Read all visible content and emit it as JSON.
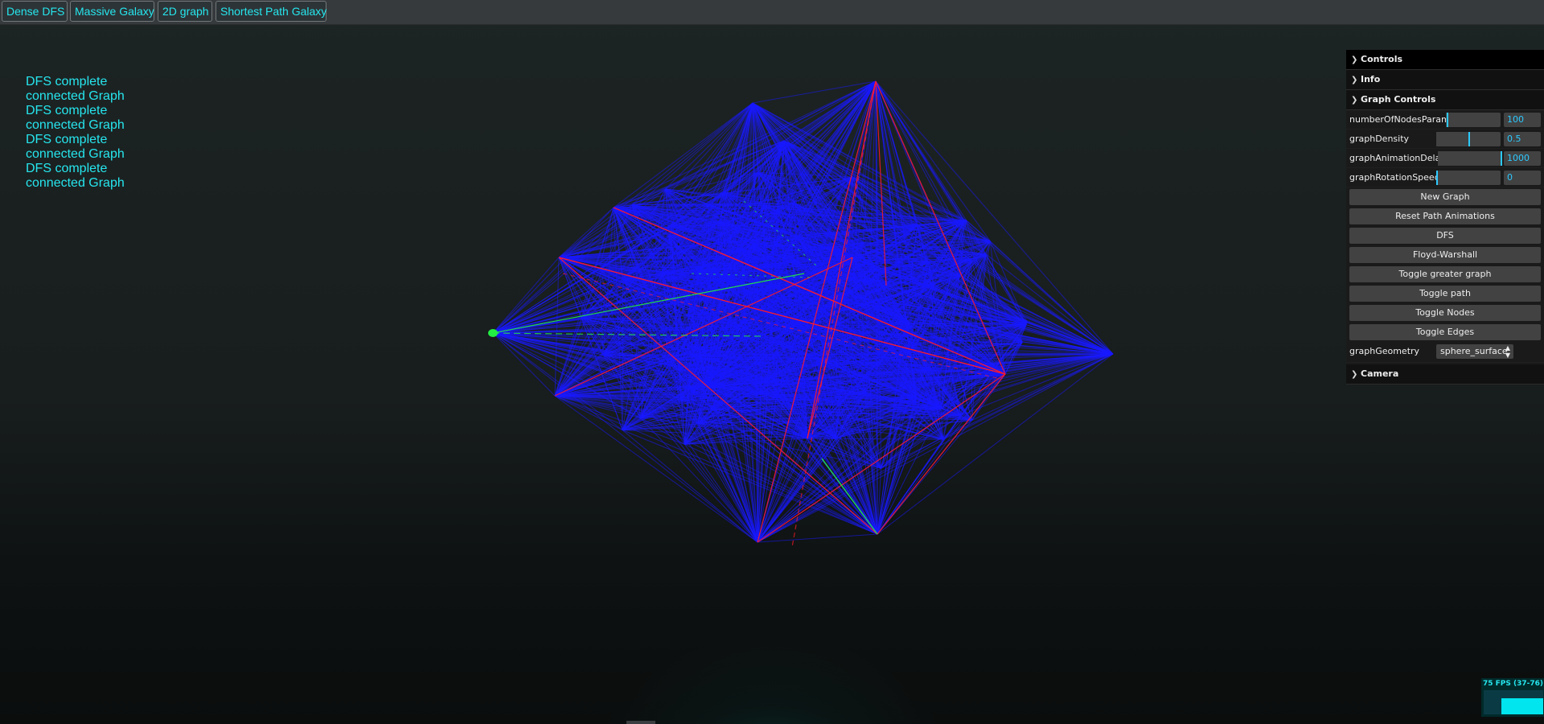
{
  "toolbar": {
    "buttons": [
      "Dense DFS",
      "Massive Galaxy",
      "2D graph",
      "Shortest Path Galaxy"
    ]
  },
  "log": [
    "DFS complete",
    "connected Graph",
    "DFS complete",
    "connected Graph",
    "DFS complete",
    "connected Graph",
    "DFS complete",
    "connected Graph"
  ],
  "panel": {
    "controls_title": "Controls",
    "info_title": "Info",
    "graph_controls_title": "Graph Controls",
    "params": [
      {
        "label": "numberOfNodesParam",
        "value": "100",
        "fill": 0.02
      },
      {
        "label": "graphDensity",
        "value": "0.5",
        "fill": 0.5
      },
      {
        "label": "graphAnimationDelay",
        "value": "1000",
        "fill": 1.0
      },
      {
        "label": "graphRotationSpeed",
        "value": "0",
        "fill": 0.0
      }
    ],
    "buttons": [
      "New Graph",
      "Reset Path Animations",
      "DFS",
      "Floyd-Warshall",
      "Toggle greater graph",
      "Toggle path",
      "Toggle Nodes",
      "Toggle Edges"
    ],
    "geometry_label": "graphGeometry",
    "geometry_value": "sphere_surface",
    "camera_title": "Camera"
  },
  "fps": {
    "text": "75 FPS (37-76)"
  },
  "colors": {
    "accent": "#26e6ee",
    "edge": "#1a1aff",
    "path": "#ff1a2a",
    "dfs": "#22ee44",
    "panel_value": "#2cc9ff"
  },
  "icons": {
    "folder_open": "chevron-down-icon",
    "folder_closed": "chevron-right-icon",
    "select": "up-down-arrows-icon"
  }
}
